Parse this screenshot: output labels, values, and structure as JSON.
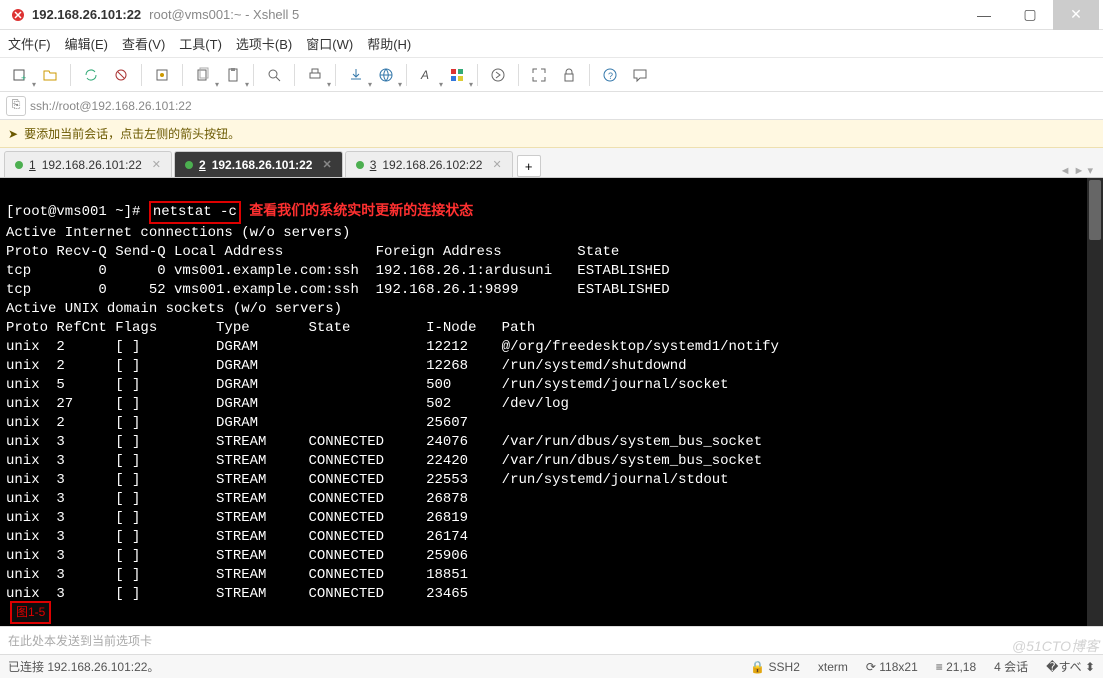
{
  "window": {
    "title_main": "192.168.26.101:22",
    "title_sub": "root@vms001:~ - Xshell 5"
  },
  "menu": {
    "file": "文件(F)",
    "edit": "编辑(E)",
    "view": "查看(V)",
    "tools": "工具(T)",
    "tabs": "选项卡(B)",
    "window": "窗口(W)",
    "help": "帮助(H)"
  },
  "addressbar": {
    "url": "ssh://root@192.168.26.101:22"
  },
  "hint": {
    "text": "要添加当前会话，点击左侧的箭头按钮。"
  },
  "tabs": [
    {
      "num": "1",
      "label": "192.168.26.101:22",
      "active": false
    },
    {
      "num": "2",
      "label": "192.168.26.101:22",
      "active": true
    },
    {
      "num": "3",
      "label": "192.168.26.102:22",
      "active": false
    }
  ],
  "terminal": {
    "prompt": "[root@vms001 ~]#",
    "command": "netstat -c",
    "annotation": "查看我们的系统实时更新的连接状态",
    "header1": "Active Internet connections (w/o servers)",
    "cols1": "Proto Recv-Q Send-Q Local Address           Foreign Address         State",
    "inet_rows": [
      "tcp        0      0 vms001.example.com:ssh  192.168.26.1:ardusuni   ESTABLISHED",
      "tcp        0     52 vms001.example.com:ssh  192.168.26.1:9899       ESTABLISHED"
    ],
    "header2": "Active UNIX domain sockets (w/o servers)",
    "cols2": "Proto RefCnt Flags       Type       State         I-Node   Path",
    "unix_rows": [
      "unix  2      [ ]         DGRAM                    12212    @/org/freedesktop/systemd1/notify",
      "unix  2      [ ]         DGRAM                    12268    /run/systemd/shutdownd",
      "unix  5      [ ]         DGRAM                    500      /run/systemd/journal/socket",
      "unix  27     [ ]         DGRAM                    502      /dev/log",
      "unix  2      [ ]         DGRAM                    25607    ",
      "unix  3      [ ]         STREAM     CONNECTED     24076    /var/run/dbus/system_bus_socket",
      "unix  3      [ ]         STREAM     CONNECTED     22420    /var/run/dbus/system_bus_socket",
      "unix  3      [ ]         STREAM     CONNECTED     22553    /run/systemd/journal/stdout",
      "unix  3      [ ]         STREAM     CONNECTED     26878    ",
      "unix  3      [ ]         STREAM     CONNECTED     26819    ",
      "unix  3      [ ]         STREAM     CONNECTED     26174    ",
      "unix  3      [ ]         STREAM     CONNECTED     25906    ",
      "unix  3      [ ]         STREAM     CONNECTED     18851    ",
      "unix  3      [ ]         STREAM     CONNECTED     23465    "
    ],
    "figure_label": "图1-5"
  },
  "inputbar": {
    "placeholder": "在此处本发送到当前选项卡"
  },
  "status": {
    "connection": "已连接 192.168.26.101:22。",
    "protocol": "SSH2",
    "term": "xterm",
    "size": "118x21",
    "cursor": "21,18",
    "sessions": "4 会话",
    "extra": "↑ ↓"
  },
  "watermark": "@51CTO博客"
}
